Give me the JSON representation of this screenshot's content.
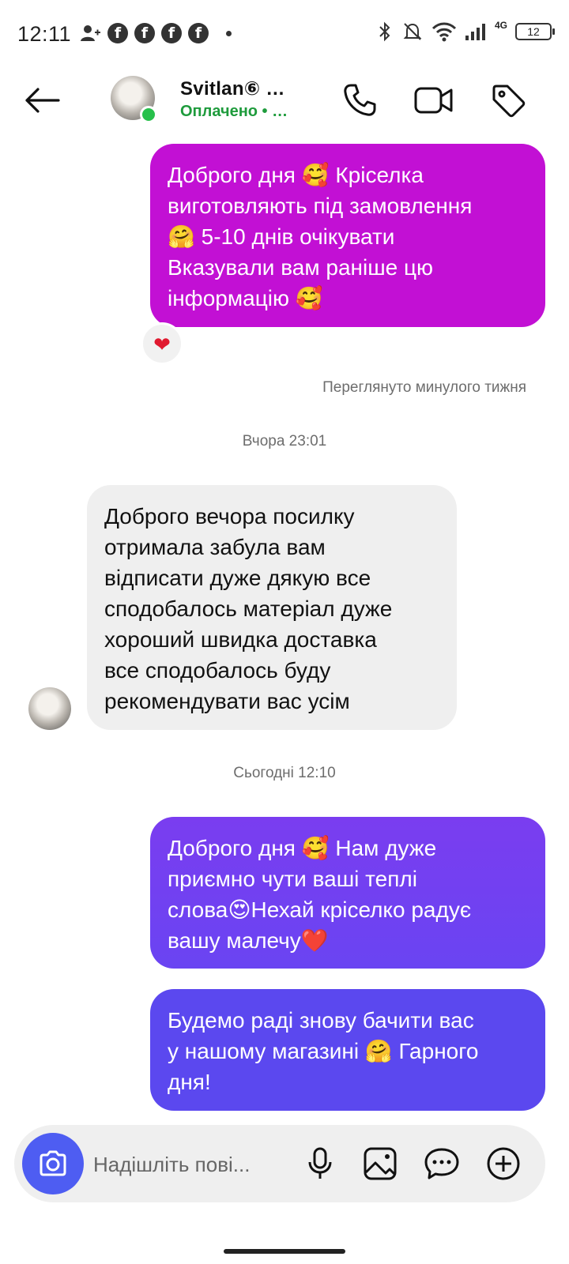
{
  "status_bar": {
    "time": "12:11",
    "network": "4G",
    "battery": "12"
  },
  "header": {
    "contact_name": "Svitlan⑥ …",
    "contact_status": "Оплачено • …"
  },
  "messages": [
    {
      "direction": "outgoing",
      "lines": [
        "Доброго дня 🥰 Кріселка",
        "виготовляють під замовлення",
        "🤗 5-10 днів очікувати",
        "Вказували вам раніше цю",
        "інформацію 🥰"
      ],
      "reaction": "❤"
    },
    {
      "direction": "incoming",
      "lines": [
        "Доброго вечора посилку",
        "отримала забула вам",
        "відписати дуже дякую все",
        "сподобалось матеріал дуже",
        "хороший швидка доставка",
        "все сподобалось буду",
        "рекомендувати вас усім"
      ]
    },
    {
      "direction": "outgoing",
      "lines": [
        "Доброго дня 🥰 Нам дуже",
        "приємно чути ваші теплі",
        "слова😍Нехай кріселко радує",
        "вашу малечу❤️"
      ]
    },
    {
      "direction": "outgoing",
      "lines": [
        "Будемо раді знову бачити вас",
        "у нашому магазині 🤗 Гарного",
        "дня!"
      ]
    }
  ],
  "seen_text": "Переглянуто минулого тижня",
  "timestamps": [
    "Вчора 23:01",
    "Сьогодні 12:10"
  ],
  "composer": {
    "placeholder": "Надішліть пові..."
  },
  "colors": {
    "outgoing_magenta": "#c210d4",
    "outgoing_violet": "#6a44f2",
    "outgoing_blue_violet": "#5b48ef",
    "incoming_gray": "#efefef",
    "online_green": "#27c04b",
    "camera_blue": "#4e5df2",
    "status_green": "#1e9b3c"
  },
  "icons": [
    "back-arrow-icon",
    "phone-icon",
    "video-icon",
    "tag-icon",
    "camera-icon",
    "microphone-icon",
    "gallery-icon",
    "sticker-icon",
    "plus-icon"
  ]
}
